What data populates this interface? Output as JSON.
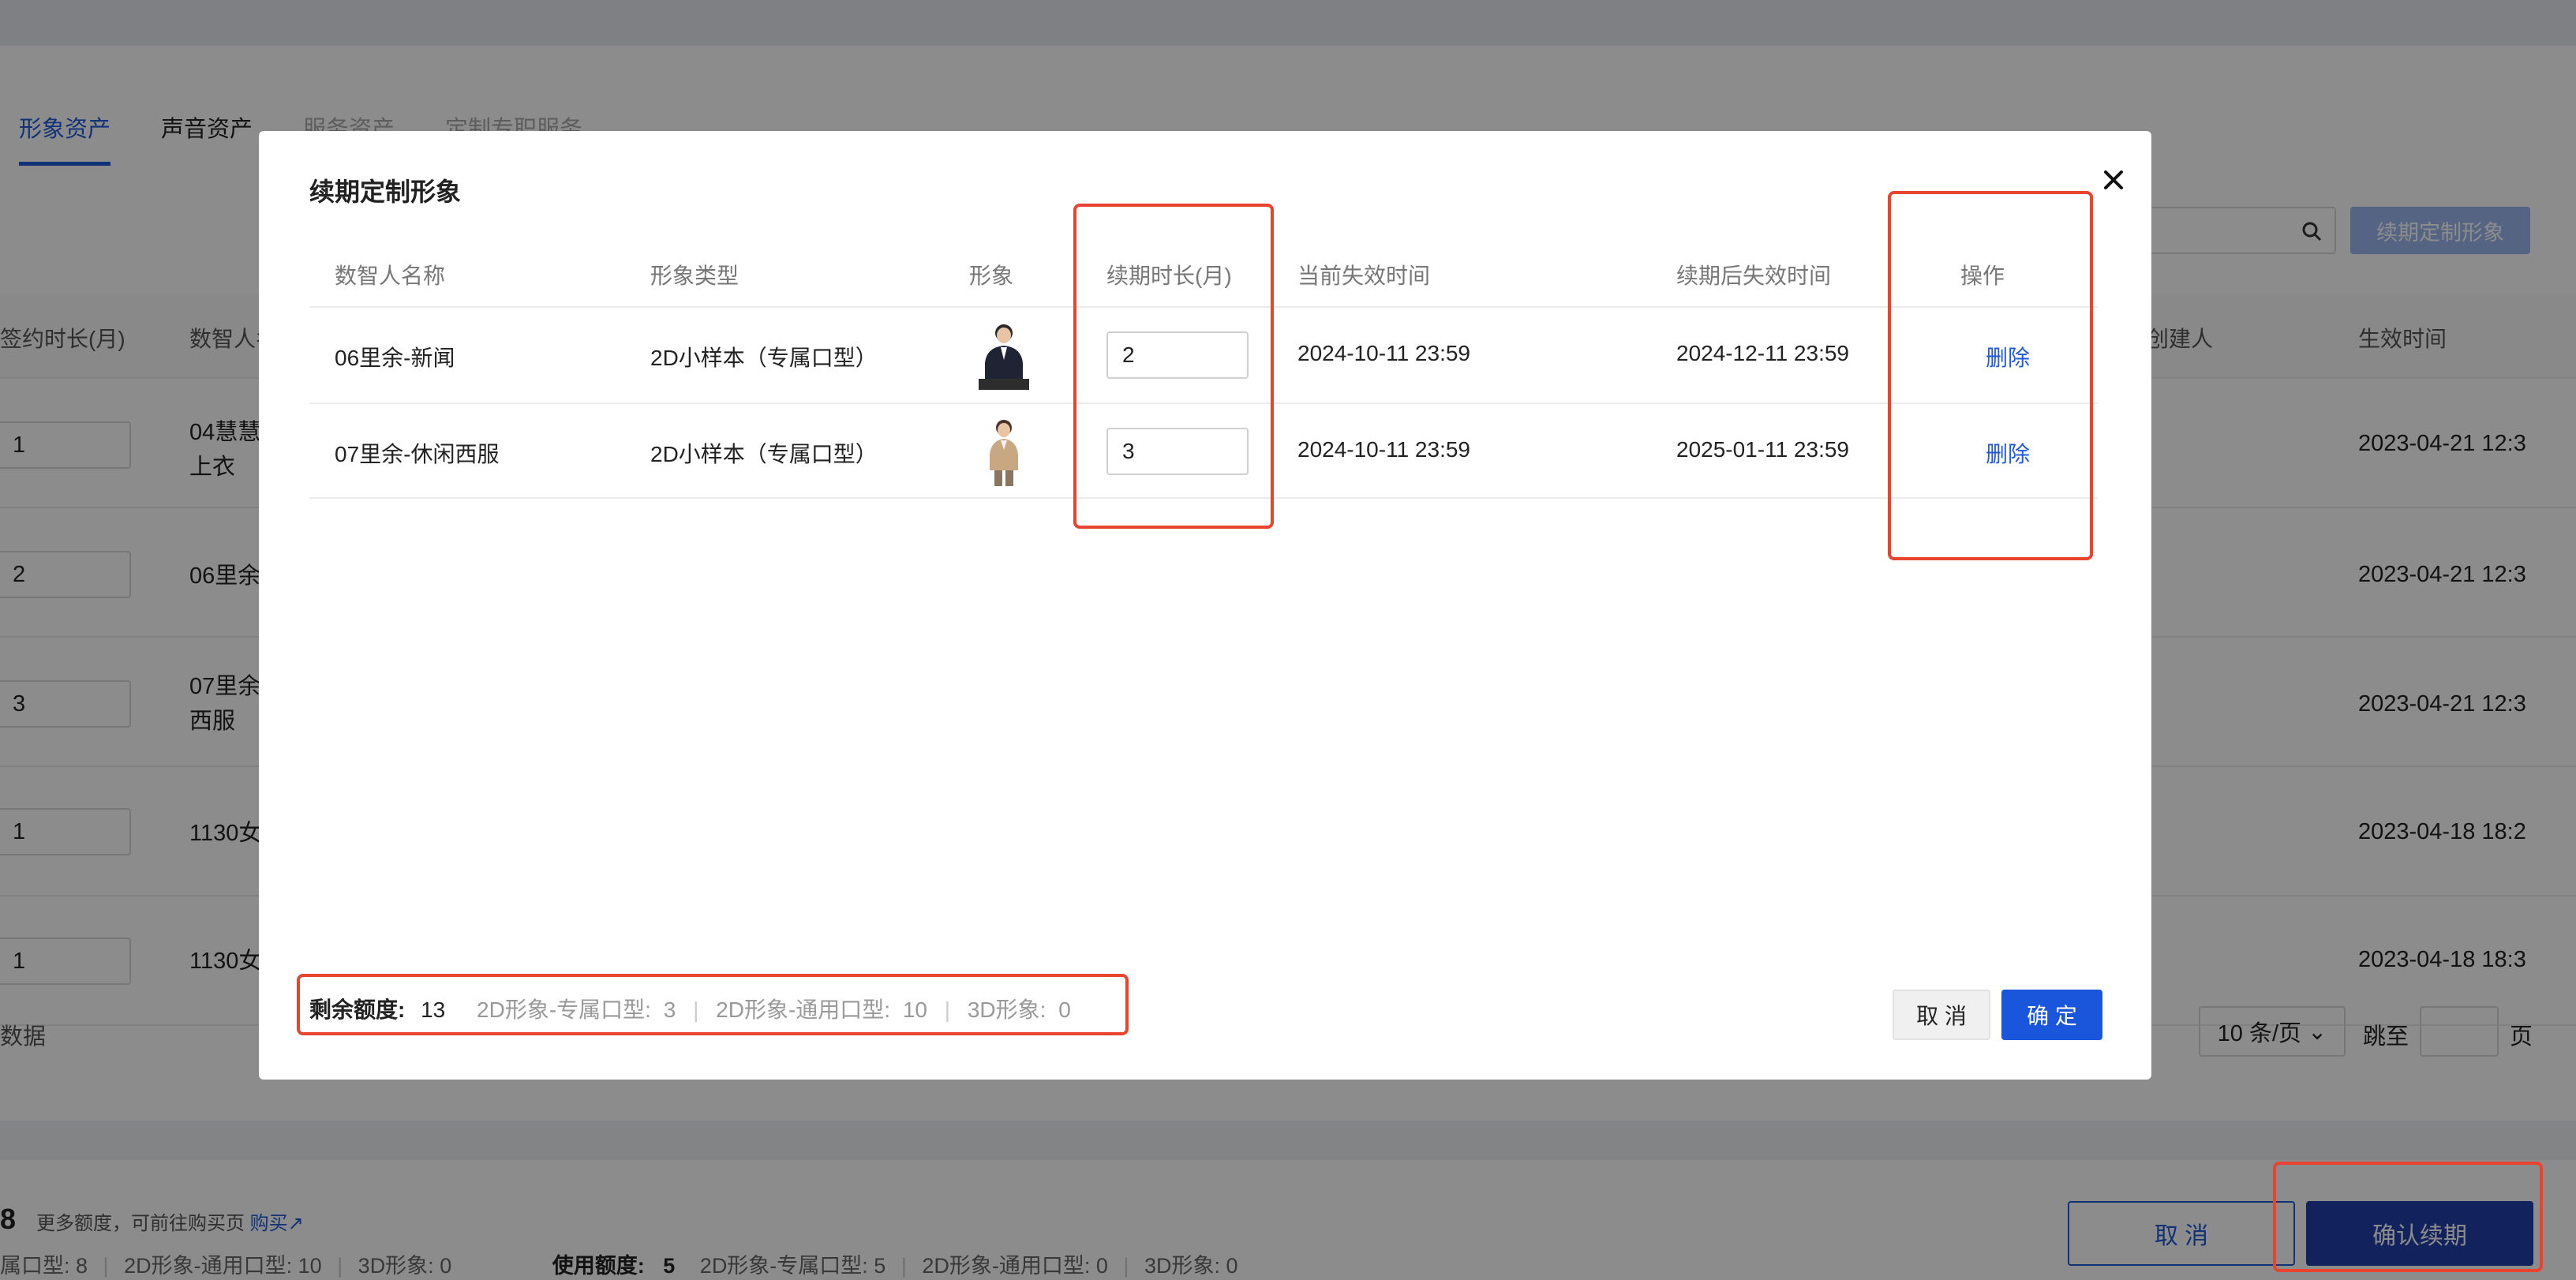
{
  "background": {
    "tabs": [
      "形象资产",
      "声音资产",
      "服务资产",
      "定制专职服务"
    ],
    "search_icon": "search-icon",
    "renew_button": "续期定制形象",
    "columns": {
      "duration": "签约时长(月)",
      "name": "数智人名称",
      "creator": "创建人",
      "effective": "生效时间"
    },
    "rows": [
      {
        "duration": "1",
        "name": "04慧慧\n上衣",
        "effective": "2023-04-21 12:3"
      },
      {
        "duration": "2",
        "name": "06里余",
        "effective": "2023-04-21 12:3"
      },
      {
        "duration": "3",
        "name": "07里余\n西服",
        "effective": "2023-04-21 12:3"
      },
      {
        "duration": "1",
        "name": "1130女",
        "effective": "2023-04-18 18:2"
      },
      {
        "duration": "1",
        "name": "1130女",
        "effective": "2023-04-18 18:3"
      }
    ],
    "no_data": "数据",
    "page_size": "10 条/页",
    "jump_to": "跳至",
    "page_unit": "页",
    "total_fragment": "8",
    "more_quota_text": "更多额度，可前往购买页",
    "buy_link": "购买",
    "quota_line_left": "属口型: 8",
    "quota_general": "2D形象-通用口型: 10",
    "quota_3d": "3D形象: 0",
    "used_label": "使用额度:",
    "used_value": "5",
    "used_exclusive": "2D形象-专属口型: 5",
    "used_general": "2D形象-通用口型: 0",
    "used_3d": "3D形象: 0",
    "cancel": "取 消",
    "confirm": "确认续期"
  },
  "modal": {
    "title": "续期定制形象",
    "close_icon": "close-icon",
    "headers": [
      "数智人名称",
      "形象类型",
      "形象",
      "续期时长(月)",
      "当前失效时间",
      "续期后失效时间",
      "操作"
    ],
    "rows": [
      {
        "name": "06里余-新闻",
        "type": "2D小样本（专属口型）",
        "avatar": "avatar-suit-icon",
        "duration": "2",
        "current_expiry": "2024-10-11 23:59",
        "new_expiry": "2024-12-11 23:59",
        "action": "删除"
      },
      {
        "name": "07里余-休闲西服",
        "type": "2D小样本（专属口型）",
        "avatar": "avatar-casual-icon",
        "duration": "3",
        "current_expiry": "2024-10-11 23:59",
        "new_expiry": "2025-01-11 23:59",
        "action": "删除"
      }
    ],
    "quota_label": "剩余额度:",
    "quota_value": "13",
    "quota_exclusive_label": "2D形象-专属口型:",
    "quota_exclusive_value": "3",
    "quota_general_label": "2D形象-通用口型:",
    "quota_general_value": "10",
    "quota_3d_label": "3D形象:",
    "quota_3d_value": "0",
    "cancel": "取 消",
    "ok": "确 定"
  },
  "colors": {
    "accent": "#1a56db",
    "highlight": "#e8442f"
  }
}
